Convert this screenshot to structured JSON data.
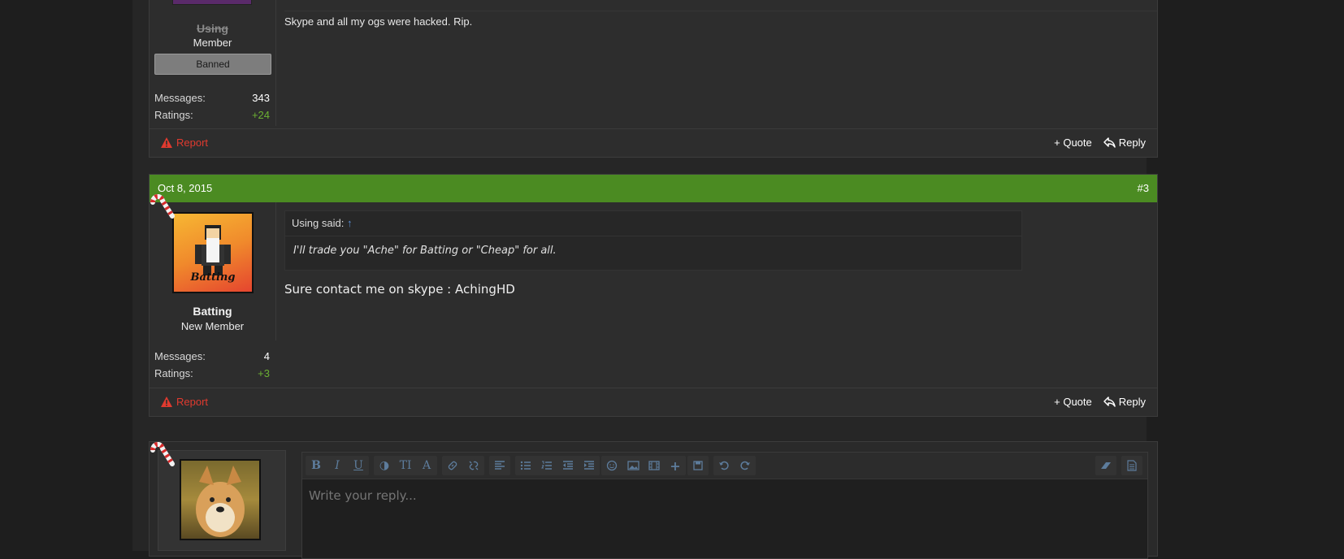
{
  "post1": {
    "username": "Using",
    "user_title": "Member",
    "badge": "Banned",
    "stats": [
      {
        "label": "Messages:",
        "value": "343"
      },
      {
        "label": "Ratings:",
        "value": "+24"
      }
    ],
    "body": "Skype and all my ogs were hacked. Rip.",
    "report_label": "Report",
    "quote_label": "+ Quote",
    "reply_label": "Reply"
  },
  "post2": {
    "date": "Oct 8, 2015",
    "number": "#3",
    "username": "Batting",
    "user_title": "New Member",
    "avatar_text": "Batting",
    "stats": [
      {
        "label": "Messages:",
        "value": "4"
      },
      {
        "label": "Ratings:",
        "value": "+3"
      }
    ],
    "quote": {
      "author": "Using said:",
      "arrow": "↑",
      "text": "I'll trade you \"Ache\" for Batting or \"Cheap\" for all."
    },
    "body": "Sure contact me on skype : AchingHD",
    "report_label": "Report",
    "quote_label": "+ Quote",
    "reply_label": "Reply"
  },
  "reply": {
    "placeholder": "Write your reply..."
  },
  "colors": {
    "header_green": "#4b8b22",
    "report_red": "#e03a2f",
    "rating_green": "#6cb033"
  }
}
